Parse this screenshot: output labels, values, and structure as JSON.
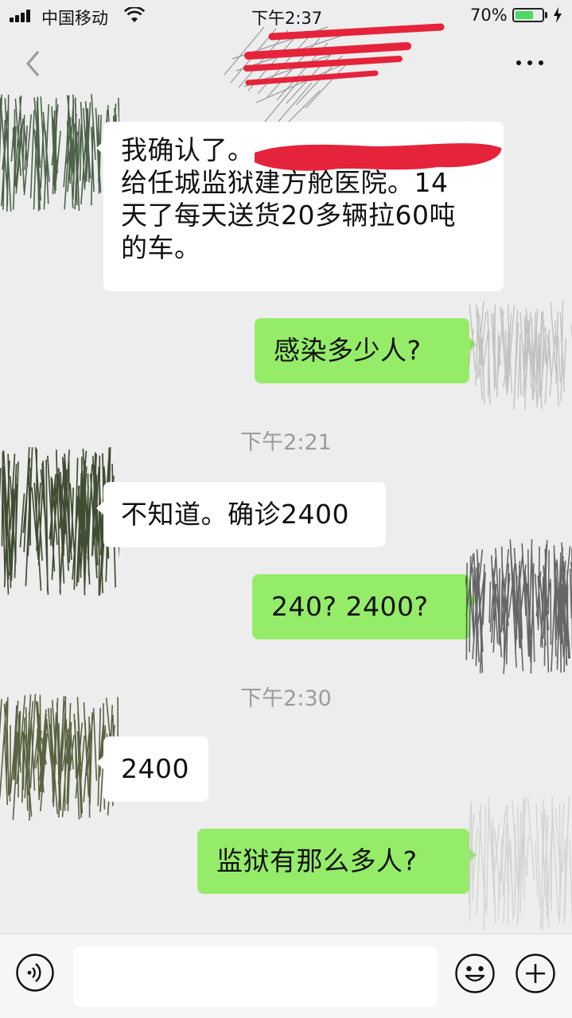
{
  "status_bar": {
    "carrier": "中国移动",
    "time": "下午2:37",
    "battery_percent": "70%",
    "battery_level": 0.7,
    "battery_color": "#4cd964"
  },
  "nav": {
    "back_icon": "chevron-left-icon",
    "more_icon": "more-dots-icon"
  },
  "messages": [
    {
      "side": "in",
      "text": "我确认了。\n给任城监狱建方舱医院。14\n天了每天送货20多辆拉60吨\n的车。"
    },
    {
      "side": "out",
      "text": "感染多少人?"
    },
    {
      "side": "time",
      "text": "下午2:21"
    },
    {
      "side": "in",
      "text": "不知道。确诊2400"
    },
    {
      "side": "out",
      "text": "240?  2400?"
    },
    {
      "side": "time",
      "text": "下午2:30"
    },
    {
      "side": "in",
      "text": "2400"
    },
    {
      "side": "out",
      "text": "监狱有那么多人?"
    }
  ],
  "input_bar": {
    "placeholder": "",
    "voice_icon": "voice-icon",
    "emoji_icon": "emoji-icon",
    "plus_icon": "plus-icon"
  },
  "colors": {
    "incoming_bubble": "#ffffff",
    "outgoing_bubble": "#95ec69",
    "background": "#ededed",
    "redaction_red": "#e5233b"
  }
}
